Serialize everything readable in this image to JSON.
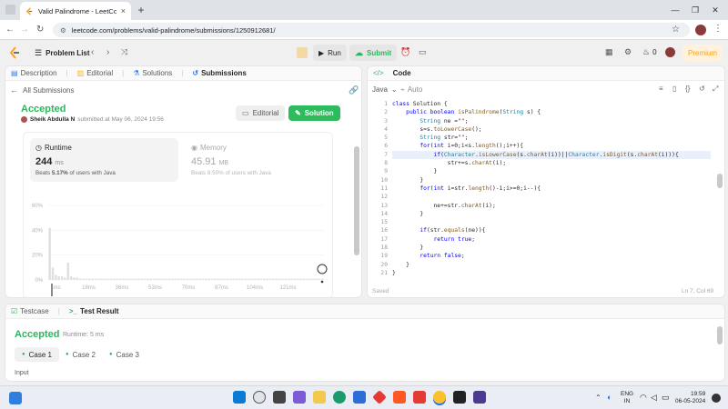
{
  "browser": {
    "tab_title": "Valid Palindrome - LeetCode",
    "url": "leetcode.com/problems/valid-palindrome/submissions/1250912681/"
  },
  "nav": {
    "problem_list": "Problem List",
    "run": "Run",
    "submit": "Submit",
    "fire_count": "0",
    "premium": "Premium"
  },
  "left_tabs": [
    "Description",
    "Editorial",
    "Solutions",
    "Submissions"
  ],
  "submission": {
    "all_label": "All Submissions",
    "status": "Accepted",
    "author": "Sheik Abdulla N",
    "meta": "submitted at May 06, 2024 19:56",
    "editorial_btn": "Editorial",
    "solution_btn": "Solution",
    "runtime_label": "Runtime",
    "runtime_value": "244",
    "runtime_unit": "ms",
    "runtime_beats_pre": "Beats",
    "runtime_beats": "5.17%",
    "runtime_beats_post": "of users with Java",
    "memory_label": "Memory",
    "memory_value": "45.91",
    "memory_unit": "MB",
    "memory_beats_pre": "Beats",
    "memory_beats": "8.50%",
    "memory_beats_post": "of users with Java"
  },
  "chart_data": {
    "type": "bar",
    "y_ticks": [
      "60%",
      "40%",
      "20%",
      "0%"
    ],
    "x_ticks": [
      "1ms",
      "18ms",
      "36ms",
      "53ms",
      "70ms",
      "87ms",
      "104ms",
      "121ms"
    ],
    "ylim": [
      0,
      60
    ],
    "values": [
      42,
      10,
      4,
      3,
      3,
      2,
      14,
      3,
      2,
      2,
      1,
      1,
      1,
      1,
      1,
      1,
      1,
      1,
      1,
      1,
      1,
      1,
      1,
      1,
      1,
      1,
      1,
      1,
      1,
      1,
      1,
      1,
      1,
      1,
      1,
      1,
      1,
      1,
      1,
      1,
      1,
      1,
      1,
      1,
      1,
      1,
      1,
      1,
      1,
      1,
      1,
      1,
      1,
      1,
      1,
      1,
      1,
      1,
      1,
      1,
      1,
      1,
      1,
      1,
      1,
      1,
      1,
      1,
      1,
      1,
      1,
      1,
      1,
      1,
      1,
      1,
      1,
      1,
      1,
      1,
      1,
      1,
      1,
      1,
      1,
      1,
      1,
      1,
      1,
      1
    ]
  },
  "editor": {
    "title": "Code",
    "language": "Java",
    "mode": "Auto",
    "saved": "Saved",
    "position": "Ln 7, Col 69",
    "line_numbers": [
      "1",
      "2",
      "3",
      "4",
      "5",
      "6",
      "7",
      "8",
      "9",
      "10",
      "11",
      "12",
      "13",
      "14",
      "15",
      "16",
      "17",
      "18",
      "19",
      "20",
      "21"
    ]
  },
  "bottom": {
    "tab_testcase": "Testcase",
    "tab_result": "Test Result",
    "status": "Accepted",
    "runtime": "Runtime: 5 ms",
    "cases": [
      "Case 1",
      "Case 2",
      "Case 3"
    ],
    "input_label": "Input"
  },
  "taskbar": {
    "lang1": "ENG",
    "lang2": "IN",
    "time": "19:59",
    "date": "06-05-2024"
  },
  "colors": {
    "accent": "#2cbb5d",
    "accepted": "#2db55d",
    "premium": "#ffa116",
    "submit": "#2db55d"
  }
}
